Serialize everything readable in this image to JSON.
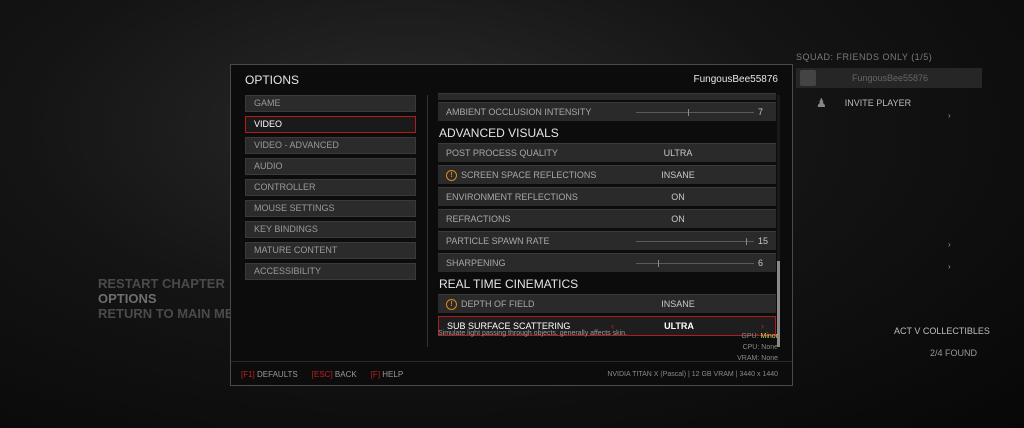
{
  "background": {
    "squad_title": "SQUAD: FRIENDS ONLY (1/5)",
    "squad_member": "FungousBee55876",
    "invite_label": "INVITE PLAYER",
    "menu": [
      "RESTART CHAPTER",
      "OPTIONS",
      "RETURN TO MAIN MENU"
    ],
    "collectibles_title": "ACT V COLLECTIBLES",
    "collectibles_found": "2/4 FOUND"
  },
  "modal": {
    "title": "OPTIONS",
    "username": "FungousBee55876"
  },
  "nav": {
    "items": [
      "GAME",
      "VIDEO",
      "VIDEO - ADVANCED",
      "AUDIO",
      "CONTROLLER",
      "MOUSE SETTINGS",
      "KEY BINDINGS",
      "MATURE CONTENT",
      "ACCESSIBILITY"
    ],
    "active": "VIDEO"
  },
  "settings": {
    "ambient_occlusion": {
      "label": "AMBIENT OCCLUSION INTENSITY",
      "value": "7",
      "level": 0.47
    },
    "advanced_visuals_header": "ADVANCED VISUALS",
    "post_process": {
      "label": "POST PROCESS QUALITY",
      "value": "ULTRA"
    },
    "ssr": {
      "label": "SCREEN SPACE REFLECTIONS",
      "value": "INSANE"
    },
    "env_reflections": {
      "label": "ENVIRONMENT REFLECTIONS",
      "value": "ON"
    },
    "refractions": {
      "label": "REFRACTIONS",
      "value": "ON"
    },
    "particle_spawn": {
      "label": "PARTICLE SPAWN RATE",
      "value": "15",
      "level": 1.0
    },
    "sharpening": {
      "label": "SHARPENING",
      "value": "6",
      "level": 0.2
    },
    "cinematics_header": "REAL TIME CINEMATICS",
    "dof": {
      "label": "DEPTH OF FIELD",
      "value": "INSANE"
    },
    "sss": {
      "label": "SUB SURFACE SCATTERING",
      "value": "ULTRA"
    }
  },
  "description": "Simulate light passing through objects, generally affects skin.",
  "sysinfo": {
    "gpu_label": "GPU:",
    "gpu_value": "Minor",
    "cpu_label": "CPU:",
    "cpu_value": "None",
    "vram_label": "VRAM:",
    "vram_value": "None"
  },
  "footer": {
    "defaults_key": "[F1]",
    "defaults_label": "DEFAULTS",
    "back_key": "[ESC]",
    "back_label": "BACK",
    "help_key": "[F]",
    "help_label": "HELP",
    "gpu_info": "NVIDIA TITAN X (Pascal) | 12 GB VRAM | 3440 x 1440"
  },
  "colors": {
    "accent": "#b01c1c",
    "warning": "#d98a1a",
    "impact_minor": "#e0d25a"
  }
}
